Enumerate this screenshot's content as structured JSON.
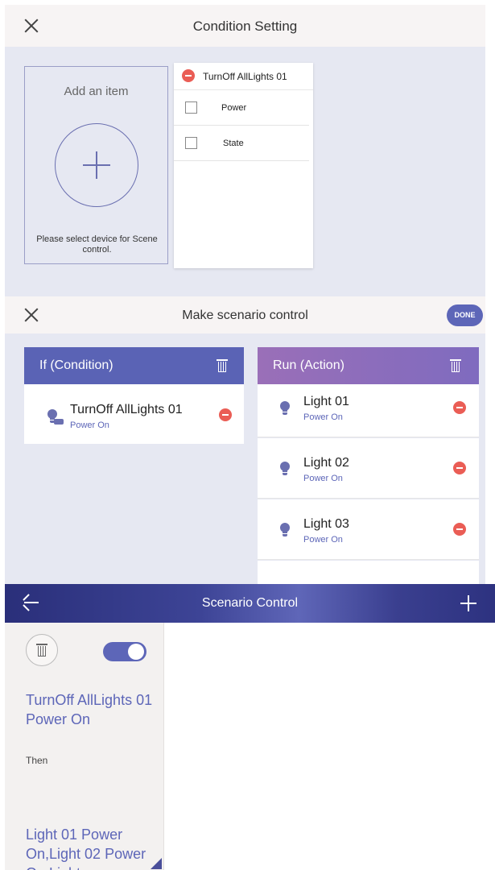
{
  "condition_setting": {
    "title": "Condition Setting",
    "add_item": {
      "title": "Add an item",
      "hint": "Please select device for Scene control."
    },
    "device": {
      "name": "TurnOff AllLights 01",
      "options": [
        {
          "label": "Power",
          "checked": false
        },
        {
          "label": "State",
          "checked": false
        }
      ]
    }
  },
  "make_scenario": {
    "title": "Make scenario control",
    "done_label": "DONE",
    "condition_column": {
      "title": "If (Condition)",
      "items": [
        {
          "name": "TurnOff AllLights 01",
          "state": "Power On"
        }
      ]
    },
    "action_column": {
      "title": "Run (Action)",
      "items": [
        {
          "name": "Light 01",
          "state": "Power On"
        },
        {
          "name": "Light 02",
          "state": "Power On"
        },
        {
          "name": "Light 03",
          "state": "Power On"
        }
      ]
    }
  },
  "scenario_control": {
    "title": "Scenario Control",
    "enabled": true,
    "condition_text": "TurnOff AllLights 01 Power On",
    "then_label": "Then",
    "action_text": "Light 01 Power On,Light 02 Power On,Light"
  },
  "colors": {
    "accent": "#5d66b8",
    "remove": "#ea5d55",
    "condition_header": "#5a63b5",
    "action_header": "#8a6bb8"
  },
  "icons": [
    "close-icon",
    "add-icon",
    "remove-icon",
    "checkbox-icon",
    "trash-icon",
    "bulb-icon",
    "back-arrow-icon",
    "plus-icon"
  ]
}
